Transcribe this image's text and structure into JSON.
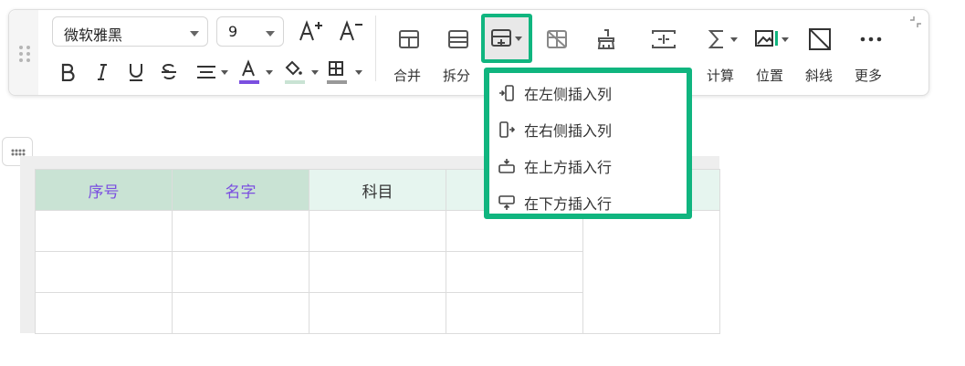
{
  "toolbar": {
    "font_family": "微软雅黑",
    "font_size": "9",
    "labels": {
      "merge": "合并",
      "split": "拆分",
      "calc": "计算",
      "position": "位置",
      "diagonal": "斜线",
      "more": "更多"
    },
    "colors": {
      "font_color": "#7b4fe0",
      "fill_color": "#c9e3d4",
      "border_color": "#999999",
      "accent": "#10b57f"
    }
  },
  "insert_menu": {
    "items": [
      {
        "label": "在左侧插入列",
        "icon": "insert-col-left-icon"
      },
      {
        "label": "在右侧插入列",
        "icon": "insert-col-right-icon"
      },
      {
        "label": "在上方插入行",
        "icon": "insert-row-above-icon"
      },
      {
        "label": "在下方插入行",
        "icon": "insert-row-below-icon"
      }
    ]
  },
  "table": {
    "headers": [
      "序号",
      "名字",
      "科目",
      ""
    ],
    "header_colors": [
      "#7b4fe0",
      "#7b4fe0",
      "#333333",
      "#333333"
    ],
    "rows": [
      [
        "",
        "",
        "",
        ""
      ],
      [
        "",
        "",
        "",
        ""
      ],
      [
        "",
        "",
        "",
        ""
      ]
    ]
  }
}
